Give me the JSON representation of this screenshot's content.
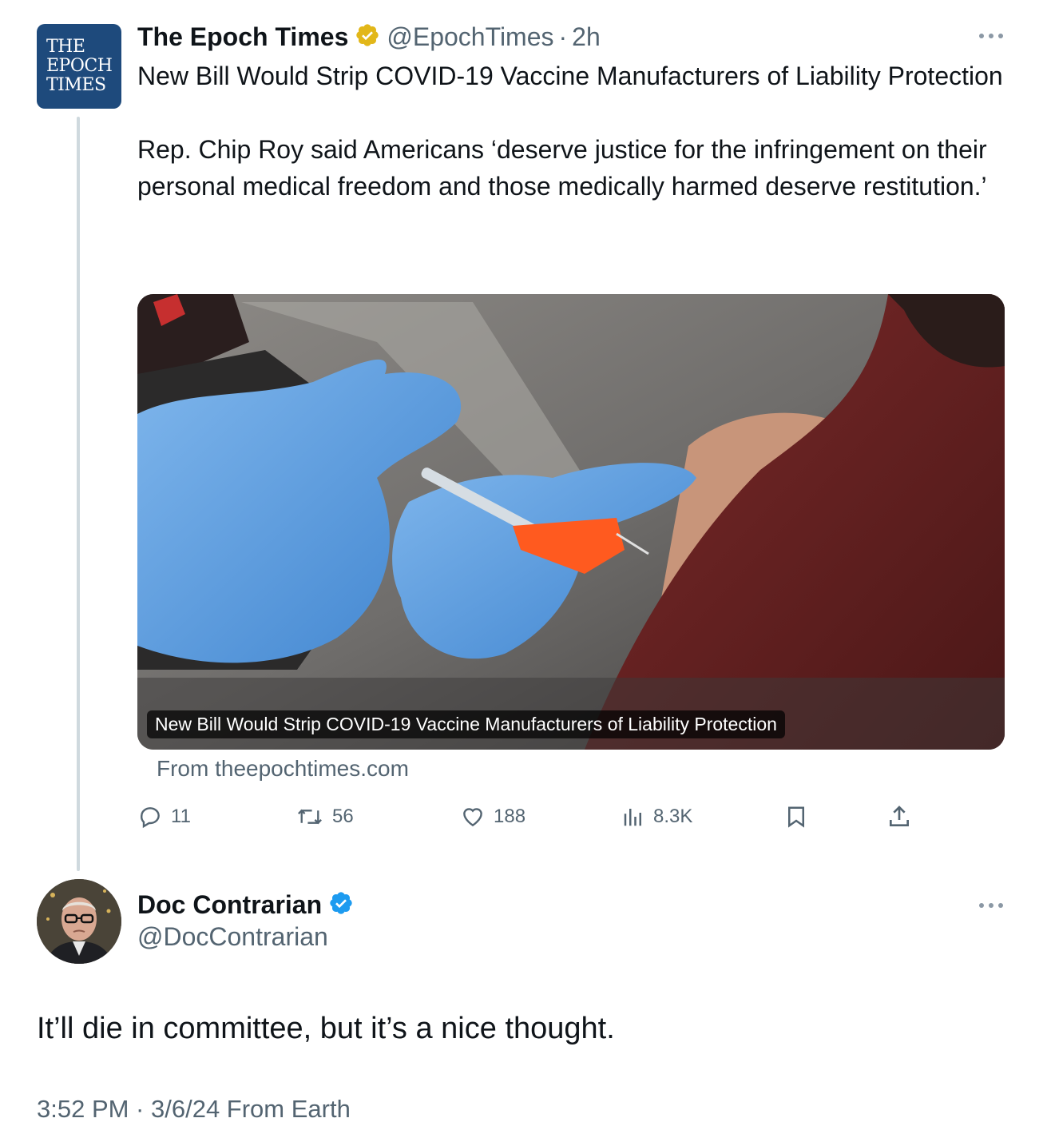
{
  "original_tweet": {
    "author_name": "The Epoch Times",
    "avatar_text": [
      "THE",
      "EPOCH",
      "TIMES"
    ],
    "handle": "@EpochTimes",
    "separator": "·",
    "time": "2h",
    "badge_color": "#e2b719",
    "text_paragraph_1": "New Bill Would Strip COVID-19 Vaccine Manufacturers of Liability Protection",
    "text_paragraph_2": "Rep. Chip Roy said Americans ‘deserve justice for the infringement on their personal medical freedom and those medically harmed deserve restitution.’",
    "card_caption": "New Bill Would Strip COVID-19 Vaccine Manufacturers of Liability Protection",
    "card_source": "From theepochtimes.com",
    "actions": {
      "replies": "11",
      "retweets": "56",
      "likes": "188",
      "views": "8.3K"
    }
  },
  "reply": {
    "author_name": "Doc Contrarian",
    "handle": "@DocContrarian",
    "badge_color": "#1d9bf0",
    "text": "It’ll die in committee, but it’s a nice thought.",
    "meta": "3:52 PM · 3/6/24 From Earth"
  },
  "icons": [
    "verified-gold-badge-icon",
    "verified-blue-badge-icon",
    "more-icon",
    "reply-icon",
    "retweet-icon",
    "like-icon",
    "views-icon",
    "bookmark-icon",
    "share-icon"
  ]
}
